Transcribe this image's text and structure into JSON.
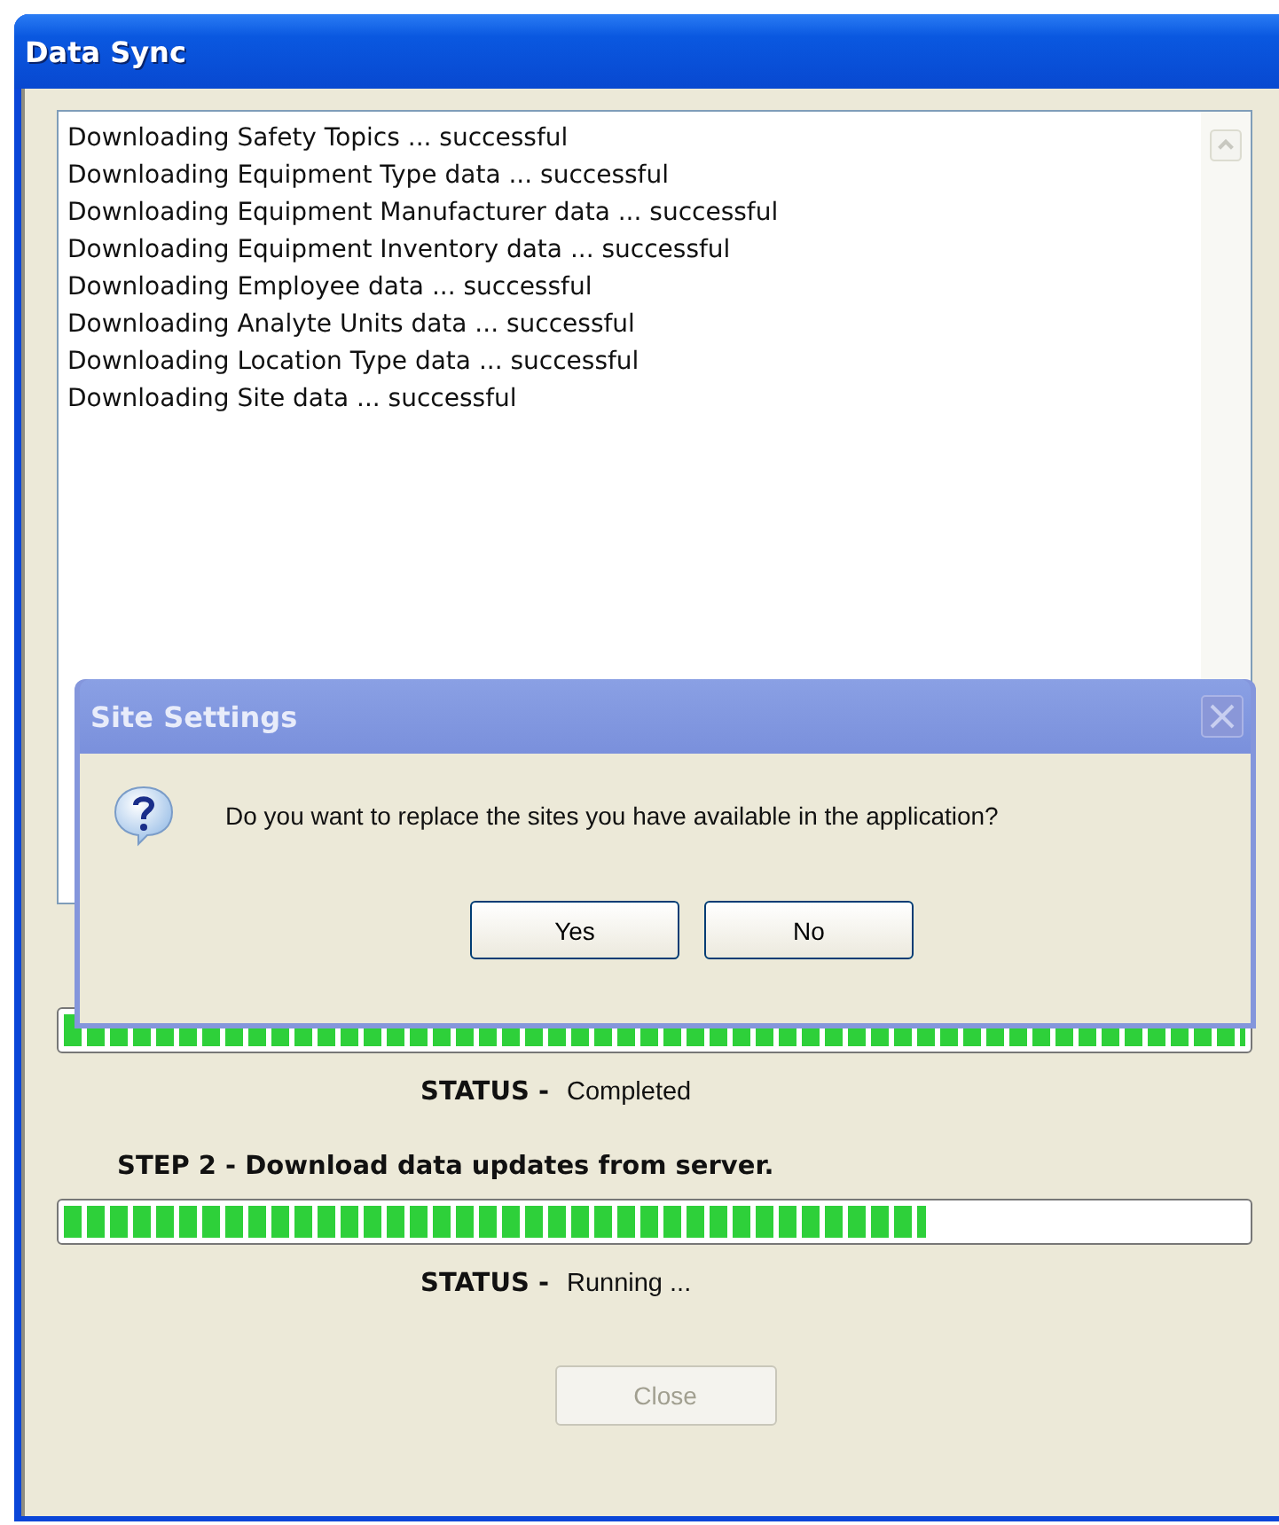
{
  "window": {
    "title": "Data Sync"
  },
  "log": [
    "Downloading Safety Topics ... successful",
    "Downloading Equipment Type data ... successful",
    "Downloading Equipment Manufacturer data ... successful",
    "Downloading Equipment Inventory data ... successful",
    "Downloading Employee data ... successful",
    "Downloading Analyte Units data ... successful",
    "Downloading Location Type data ... successful",
    "Downloading Site data ... successful"
  ],
  "steps": [
    {
      "level": 1,
      "status_label": "STATUS -",
      "status": "Completed"
    },
    {
      "label": "STEP 2 - Download data updates from server.",
      "level": 0.73,
      "status_label": "STATUS -",
      "status": "Running ..."
    }
  ],
  "close_button": {
    "label": "Close",
    "disabled": true
  },
  "dialog": {
    "title": "Site Settings",
    "message": "Do you want to replace the sites you have available in the application?",
    "buttons": [
      "Yes",
      "No"
    ]
  }
}
